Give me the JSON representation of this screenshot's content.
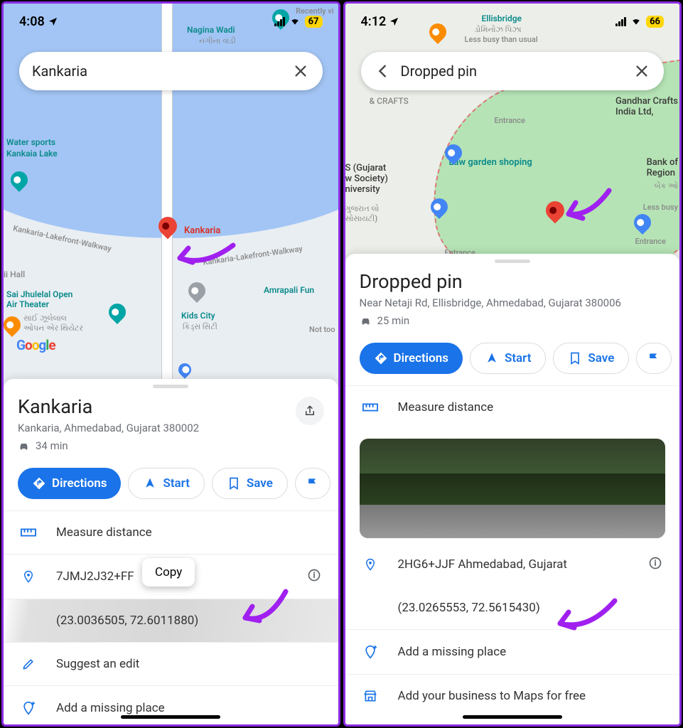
{
  "left": {
    "status": {
      "time": "4:08",
      "battery": "67"
    },
    "search": {
      "query": "Kankaria"
    },
    "map": {
      "nagina": "Nagina Wadi",
      "nagina_sub": "નગીના વાડી",
      "water_sports": "Water sports",
      "kankaia": "Kankaia Lake",
      "pin_label": "Kankaria",
      "walkway1": "Kankaria-Lakefront-Walkway",
      "walkway2": "Kankaria-Lakefront-Walkway",
      "amrapali": "Amrapali Fun",
      "kidscity": "Kids City",
      "kidscity_sub": "કિડ્સ સિટી",
      "jhulelal": "Sai Jhulelal Open\nAir Theater",
      "jhulelal_sub": "સાઈ ઝૂલેલાલ\nઓપન એર થિયેટર",
      "nottoo": "Not too",
      "hall": "ii Hall",
      "recently": "Recently vi"
    },
    "panel": {
      "title": "Kankaria",
      "address": "Kankaria, Ahmedabad, Gujarat 380002",
      "travel": "34 min",
      "directions": "Directions",
      "start": "Start",
      "save": "Save",
      "measure": "Measure distance",
      "pluscode": "7JMJ2J32+FF",
      "coords": "(23.0036505, 72.6011880)",
      "suggest": "Suggest an edit",
      "addmissing": "Add a missing place",
      "copy": "Copy"
    }
  },
  "right": {
    "status": {
      "time": "4:12",
      "battery": "66"
    },
    "search": {
      "query": "Dropped pin"
    },
    "map": {
      "ellis": "Ellisbridge",
      "ellis_sub": "ડોમિનોઝ પિઝા",
      "lessbusy": "Less busy than usual",
      "gandhar": "Gandhar Crafts\nIndia Ltd,",
      "bank": "Bank of\nRegion",
      "bank_sub": "બેંક ઓ",
      "lessb2": "Less busy",
      "crafts": "& CRAFTS",
      "entr1": "Entrance",
      "entr2": "Entrance",
      "entr3": "Entrance",
      "law": "Law garden shoping",
      "gs": "S (Gujarat\nw Society)\nniversity",
      "gs_sub": "ગુજરાત લો\nસોસાયટી)"
    },
    "panel": {
      "title": "Dropped pin",
      "address": "Near Netaji Rd, Ellisbridge, Ahmedabad, Gujarat 380006",
      "travel": "25 min",
      "directions": "Directions",
      "start": "Start",
      "save": "Save",
      "measure": "Measure distance",
      "pluscode": "2HG6+JJF Ahmedabad, Gujarat",
      "coords": "(23.0265553, 72.5615430)",
      "addmissing": "Add a missing place",
      "addbiz": "Add your business to Maps for free"
    }
  }
}
